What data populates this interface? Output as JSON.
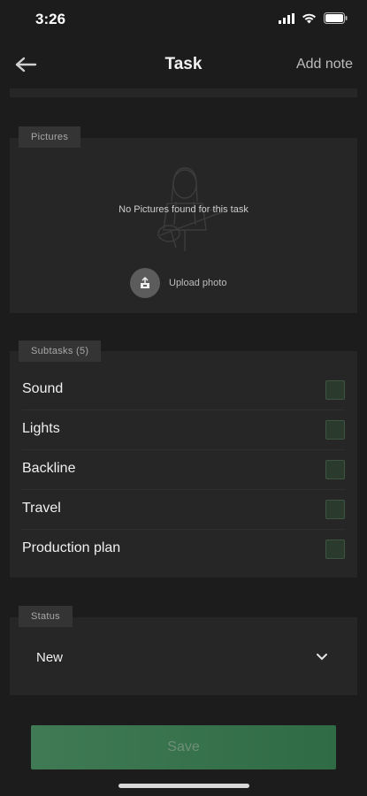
{
  "status_bar": {
    "time": "3:26"
  },
  "nav": {
    "title": "Task",
    "action_label": "Add note",
    "back_icon": "arrow-left-icon"
  },
  "pictures": {
    "section_label": "Pictures",
    "empty_message": "No Pictures found for this task",
    "upload_label": "Upload photo"
  },
  "subtasks": {
    "section_label": "Subtasks (5)",
    "items": [
      {
        "label": "Sound",
        "checked": false
      },
      {
        "label": "Lights",
        "checked": false
      },
      {
        "label": "Backline",
        "checked": false
      },
      {
        "label": "Travel",
        "checked": false
      },
      {
        "label": "Production plan",
        "checked": false
      }
    ]
  },
  "status": {
    "section_label": "Status",
    "value": "New"
  },
  "save_label": "Save",
  "colors": {
    "background": "#1c1c1c",
    "card": "#262626",
    "accent": "#3f7a55",
    "checkbox": "#2a3a2d"
  }
}
